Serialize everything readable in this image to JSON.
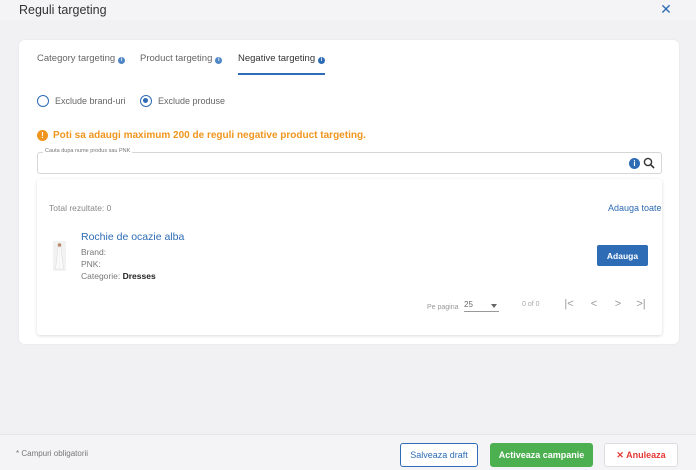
{
  "modal": {
    "title": "Reguli targeting",
    "close_icon": "close-icon"
  },
  "tabs": [
    {
      "label": "Category targeting",
      "active": false
    },
    {
      "label": "Product targeting",
      "active": false
    },
    {
      "label": "Negative targeting",
      "active": true
    }
  ],
  "radios": [
    {
      "label": "Exclude brand-uri",
      "checked": false
    },
    {
      "label": "Exclude produse",
      "checked": true
    }
  ],
  "warning": {
    "text": "Poti sa adaugi maximum 200 de reguli negative product targeting.",
    "icon": "!"
  },
  "search": {
    "legend": "Cauta dupa nume produs sau PNK",
    "value": "",
    "info_icon": "i"
  },
  "results": {
    "total_label": "Total rezultate: 0",
    "add_all_label": "Adauga toate",
    "products": [
      {
        "name": "Rochie de ocazie alba",
        "brand_label": "Brand:",
        "pnk_label": "PNK:",
        "category_label": "Categorie:",
        "category_value": "Dresses",
        "add_label": "Adauga"
      }
    ],
    "pager": {
      "per_page_label": "Pe pagina",
      "per_page_value": "25",
      "count": "0 of 0",
      "first": "|<",
      "prev": "<",
      "next": ">",
      "last": ">|"
    }
  },
  "footer": {
    "required_note": "* Campuri obligatorii",
    "save_draft": "Salveaza draft",
    "activate": "Activeaza campanie",
    "cancel_icon": "✕",
    "cancel": "Anuleaza"
  },
  "colors": {
    "primary": "#2e6cb5",
    "warning": "#f0951d",
    "success": "#4caf50",
    "danger": "#e53935"
  }
}
